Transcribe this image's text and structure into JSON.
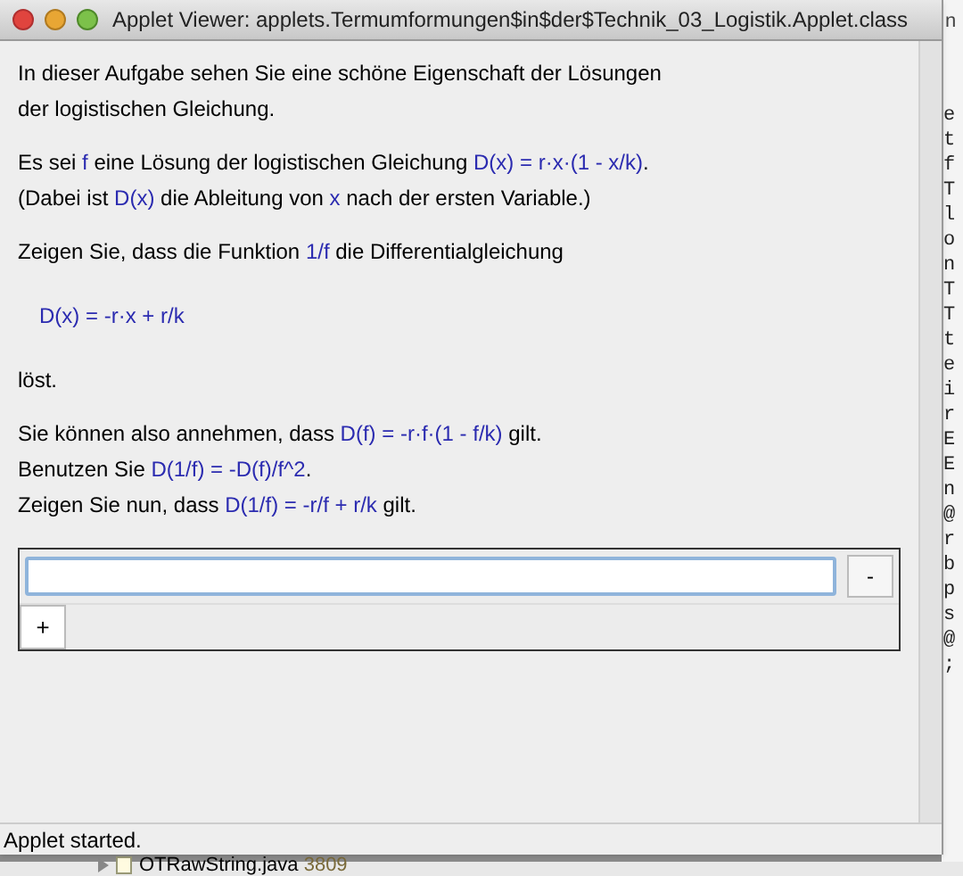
{
  "window": {
    "title": "Applet Viewer: applets.Termumformungen$in$der$Technik_03_Logistik.Applet.class"
  },
  "paragraphs": [
    {
      "lines": [
        [
          {
            "text": "In dieser Aufgabe sehen Sie eine schöne Eigenschaft der Lösungen",
            "math": false
          }
        ],
        [
          {
            "text": "der logistischen Gleichung.",
            "math": false
          }
        ]
      ]
    },
    {
      "lines": [
        [
          {
            "text": "Es sei ",
            "math": false
          },
          {
            "text": "f",
            "math": true
          },
          {
            "text": " eine Lösung der logistischen Gleichung ",
            "math": false
          },
          {
            "text": "D(x) = r·x·(1 - x/k)",
            "math": true
          },
          {
            "text": ".",
            "math": false
          }
        ],
        [
          {
            "text": "(Dabei ist ",
            "math": false
          },
          {
            "text": "D(x)",
            "math": true
          },
          {
            "text": " die Ableitung von ",
            "math": false
          },
          {
            "text": "x",
            "math": true
          },
          {
            "text": " nach der ersten Variable.)",
            "math": false
          }
        ]
      ]
    },
    {
      "lines": [
        [
          {
            "text": "Zeigen Sie, dass die Funktion ",
            "math": false
          },
          {
            "text": "1/f",
            "math": true
          },
          {
            "text": " die Differentialgleichung",
            "math": false
          }
        ]
      ]
    },
    {
      "indent": true,
      "lines": [
        [
          {
            "text": "D(x) = -r·x + r/k",
            "math": true
          }
        ]
      ]
    },
    {
      "lines": [
        [
          {
            "text": "löst.",
            "math": false
          }
        ]
      ]
    },
    {
      "lines": [
        [
          {
            "text": "Sie können also annehmen, dass ",
            "math": false
          },
          {
            "text": "D(f) = -r·f·(1 - f/k)",
            "math": true
          },
          {
            "text": " gilt.",
            "math": false
          }
        ],
        [
          {
            "text": "Benutzen Sie ",
            "math": false
          },
          {
            "text": "D(1/f) = -D(f)/f^2",
            "math": true
          },
          {
            "text": ".",
            "math": false
          }
        ],
        [
          {
            "text": "Zeigen Sie nun, dass ",
            "math": false
          },
          {
            "text": "D(1/f) = -r/f + r/k",
            "math": true
          },
          {
            "text": " gilt.",
            "math": false
          }
        ]
      ]
    }
  ],
  "answer": {
    "remove_button": "-",
    "add_button": "+"
  },
  "status_bar": "Applet started.",
  "background": {
    "title_fragment": "n",
    "code_fragments": [
      "e",
      "t",
      "f",
      "T",
      "l",
      "o",
      "n",
      "T",
      "T",
      "t",
      "e",
      "i",
      "r",
      "E",
      "E",
      "n",
      "@",
      "r",
      "b",
      "p",
      "s",
      "@",
      ";"
    ],
    "tree_item": {
      "name": "OTRawString.java",
      "revision": "3809"
    }
  }
}
